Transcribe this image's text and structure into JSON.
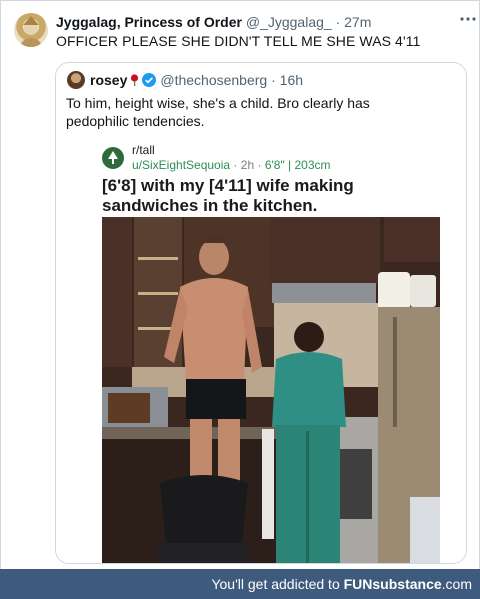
{
  "tweet": {
    "author_name": "Jyggalag, Princess of Order",
    "author_handle": "@_Jyggalag_",
    "separator": "·",
    "time": "27m",
    "text": "OFFICER PLEASE SHE DIDN'T TELL ME SHE WAS 4'11"
  },
  "quote": {
    "author_name": "rosey",
    "author_handle": "@thechosenberg",
    "separator": "·",
    "time": "16h",
    "text": "To him, height wise, she's a child.  Bro clearly has pedophilic tendencies."
  },
  "reddit_post": {
    "subreddit": "r/tall",
    "username": "u/SixEightSequoia",
    "separator": "·",
    "time": "2h",
    "flair": "6'8\" | 203cm",
    "title": "[6'8] with my [4'11] wife making sandwiches in the kitchen.",
    "image_alt": "kitchen-photo"
  },
  "banner": {
    "prefix": "You'll get addicted to ",
    "brand": "FUNsubstance",
    "suffix": ".com"
  },
  "colors": {
    "banner_bg": "#3e5b7e",
    "reddit_user": "#2e8f55",
    "meta_gray": "#536471",
    "verified": "#1d9bf0"
  }
}
